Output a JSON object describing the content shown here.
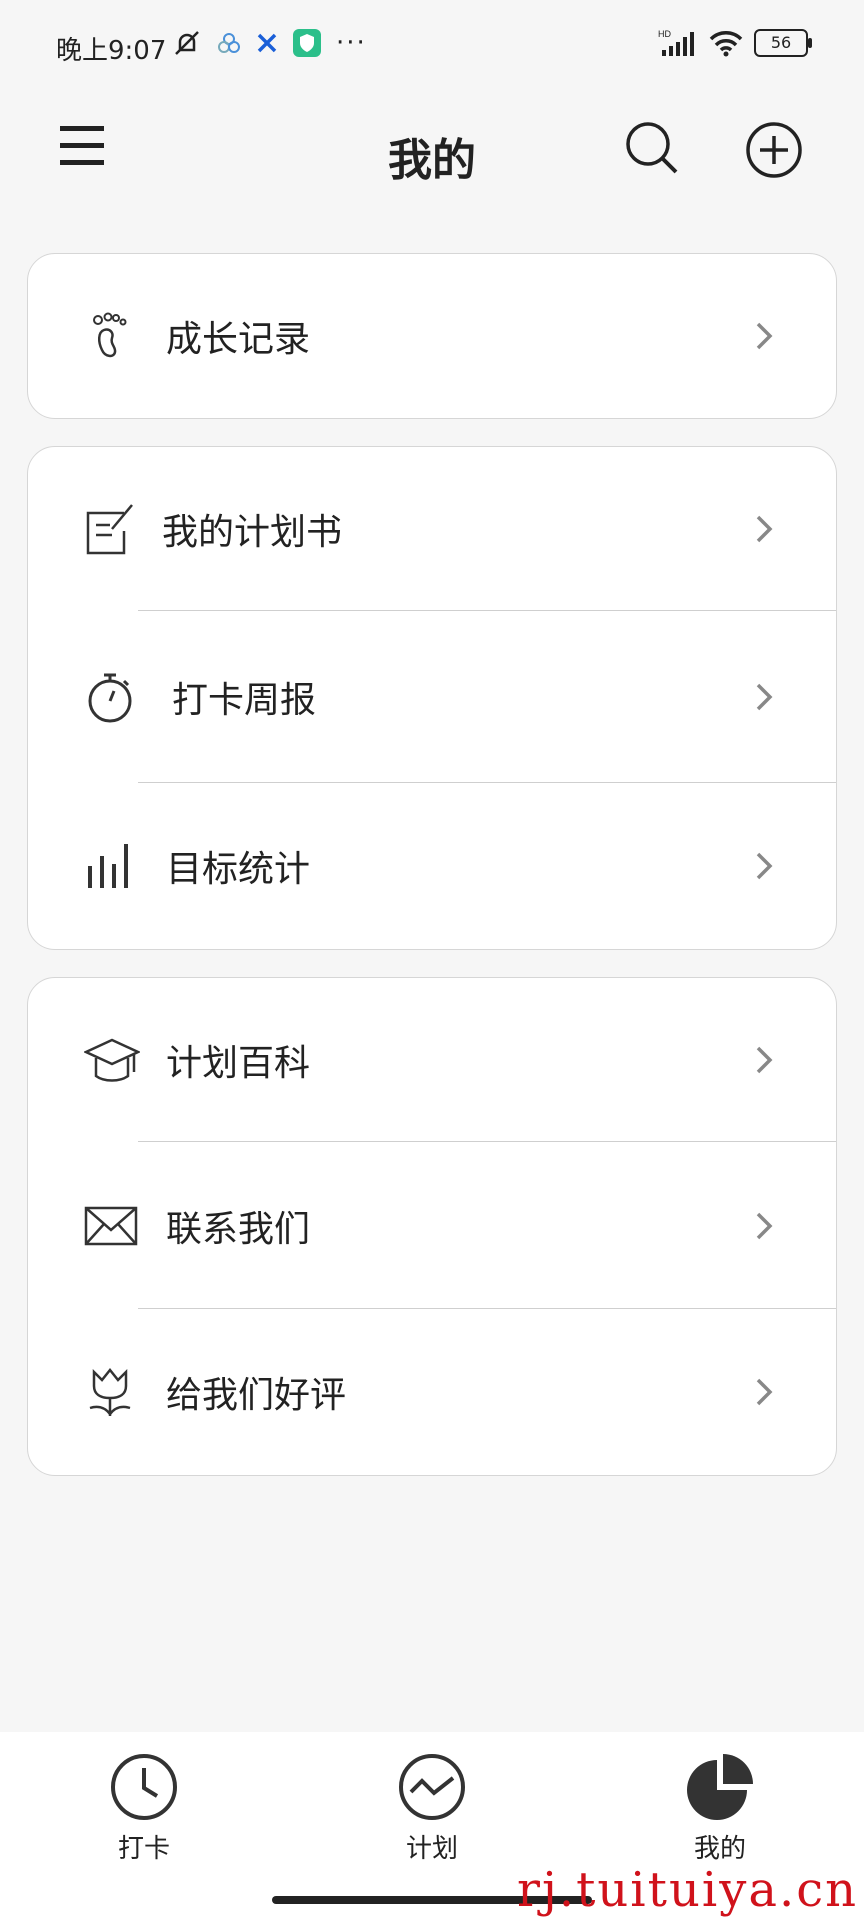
{
  "status": {
    "time": "晚上9:07",
    "battery": "56",
    "more": "···"
  },
  "header": {
    "title": "我的"
  },
  "cards": [
    {
      "items": [
        {
          "label": "成长记录",
          "icon": "footprint-icon"
        }
      ]
    },
    {
      "items": [
        {
          "label": "我的计划书",
          "icon": "note-edit-icon"
        },
        {
          "label": "打卡周报",
          "icon": "stopwatch-icon"
        },
        {
          "label": "目标统计",
          "icon": "bar-chart-icon"
        }
      ]
    },
    {
      "items": [
        {
          "label": "计划百科",
          "icon": "graduation-cap-icon"
        },
        {
          "label": "联系我们",
          "icon": "envelope-icon"
        },
        {
          "label": "给我们好评",
          "icon": "tulip-icon"
        }
      ]
    }
  ],
  "bottom_nav": [
    {
      "label": "打卡",
      "icon": "clock-icon",
      "active": false
    },
    {
      "label": "计划",
      "icon": "trend-circle-icon",
      "active": false
    },
    {
      "label": "我的",
      "icon": "pie-chart-icon",
      "active": true
    }
  ],
  "watermark": "rj.tuituiya.cn",
  "colors": {
    "background": "#f6f6f6",
    "text": "#222222",
    "chevron": "#888888",
    "watermark": "#d0121b"
  }
}
